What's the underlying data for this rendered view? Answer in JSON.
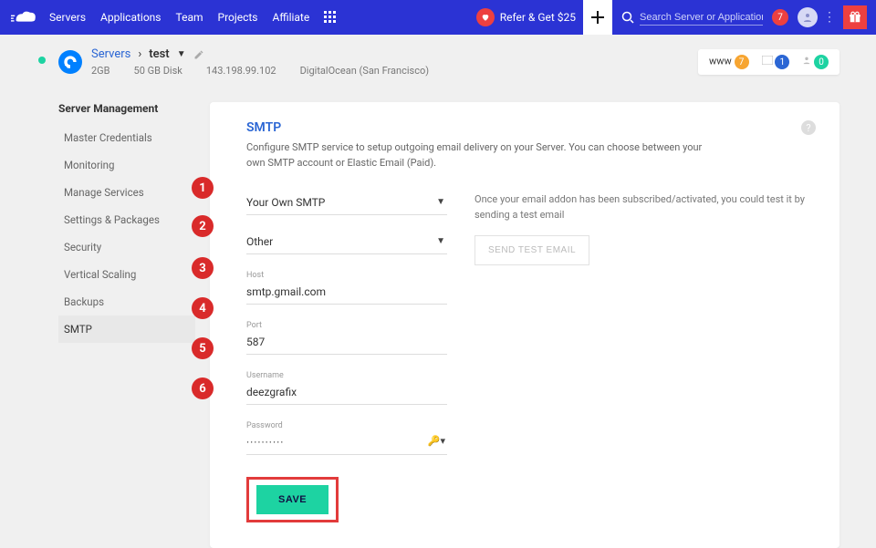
{
  "nav": {
    "links": [
      "Servers",
      "Applications",
      "Team",
      "Projects",
      "Affiliate"
    ],
    "refer": "Refer & Get $25",
    "search_placeholder": "Search Server or Application",
    "notif_count": "7"
  },
  "server": {
    "breadcrumb_root": "Servers",
    "name": "test",
    "ram": "2GB",
    "disk": "50 GB Disk",
    "ip": "143.198.99.102",
    "provider": "DigitalOcean (San Francisco)",
    "env": {
      "www": "www",
      "www_count": "7",
      "app_count": "1",
      "user_count": "0"
    }
  },
  "sidebar": {
    "title": "Server Management",
    "items": [
      "Master Credentials",
      "Monitoring",
      "Manage Services",
      "Settings & Packages",
      "Security",
      "Vertical Scaling",
      "Backups",
      "SMTP"
    ]
  },
  "smtp": {
    "title": "SMTP",
    "desc": "Configure SMTP service to setup outgoing email delivery on your Server. You can choose between your own SMTP account or Elastic Email (Paid).",
    "provider": "Your Own SMTP",
    "type": "Other",
    "host_label": "Host",
    "host": "smtp.gmail.com",
    "port_label": "Port",
    "port": "587",
    "user_label": "Username",
    "user": "deezgrafix",
    "pass_label": "Password",
    "pass": "··········",
    "hint": "Once your email addon has been subscribed/activated, you could test it by sending a test email",
    "send_label": "SEND TEST EMAIL",
    "save_label": "SAVE"
  },
  "steps": [
    "1",
    "2",
    "3",
    "4",
    "5",
    "6"
  ]
}
